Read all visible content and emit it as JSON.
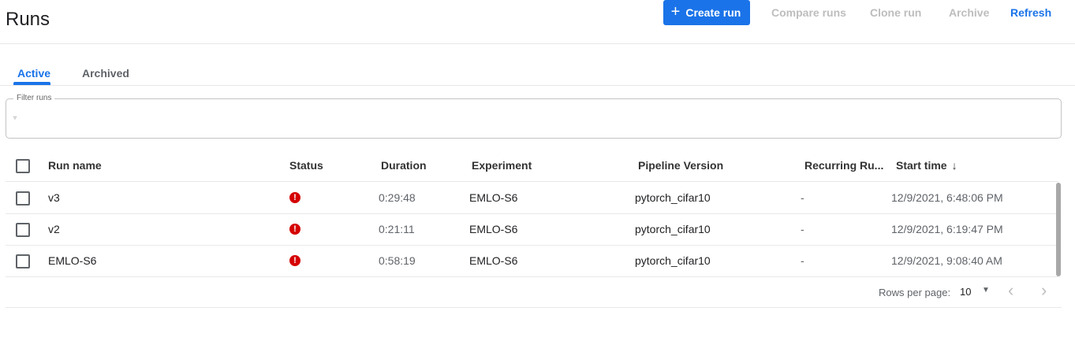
{
  "header": {
    "title": "Runs",
    "create_run": "Create run",
    "compare_runs": "Compare runs",
    "clone_run": "Clone run",
    "archive": "Archive",
    "refresh": "Refresh"
  },
  "tabs": [
    {
      "label": "Active",
      "selected": true
    },
    {
      "label": "Archived",
      "selected": false
    }
  ],
  "filter": {
    "label": "Filter runs",
    "value": ""
  },
  "table": {
    "columns": [
      "Run name",
      "Status",
      "Duration",
      "Experiment",
      "Pipeline Version",
      "Recurring Ru...",
      "Start time"
    ],
    "sort_column": "Start time",
    "sort_direction": "descending",
    "rows": [
      {
        "name": "v3",
        "status": "error",
        "duration": "0:29:48",
        "experiment": "EMLO-S6",
        "pipeline_version": "pytorch_cifar10",
        "recurring": "-",
        "start_time": "12/9/2021, 6:48:06 PM"
      },
      {
        "name": "v2",
        "status": "error",
        "duration": "0:21:11",
        "experiment": "EMLO-S6",
        "pipeline_version": "pytorch_cifar10",
        "recurring": "-",
        "start_time": "12/9/2021, 6:19:47 PM"
      },
      {
        "name": "EMLO-S6",
        "status": "error",
        "duration": "0:58:19",
        "experiment": "EMLO-S6",
        "pipeline_version": "pytorch_cifar10",
        "recurring": "-",
        "start_time": "12/9/2021, 9:08:40 AM"
      }
    ]
  },
  "pagination": {
    "rows_per_page_label": "Rows per page:",
    "rows_per_page": "10"
  },
  "colors": {
    "accent": "#1a73e8",
    "error": "#d50000",
    "disabled": "#bdbdbd"
  }
}
